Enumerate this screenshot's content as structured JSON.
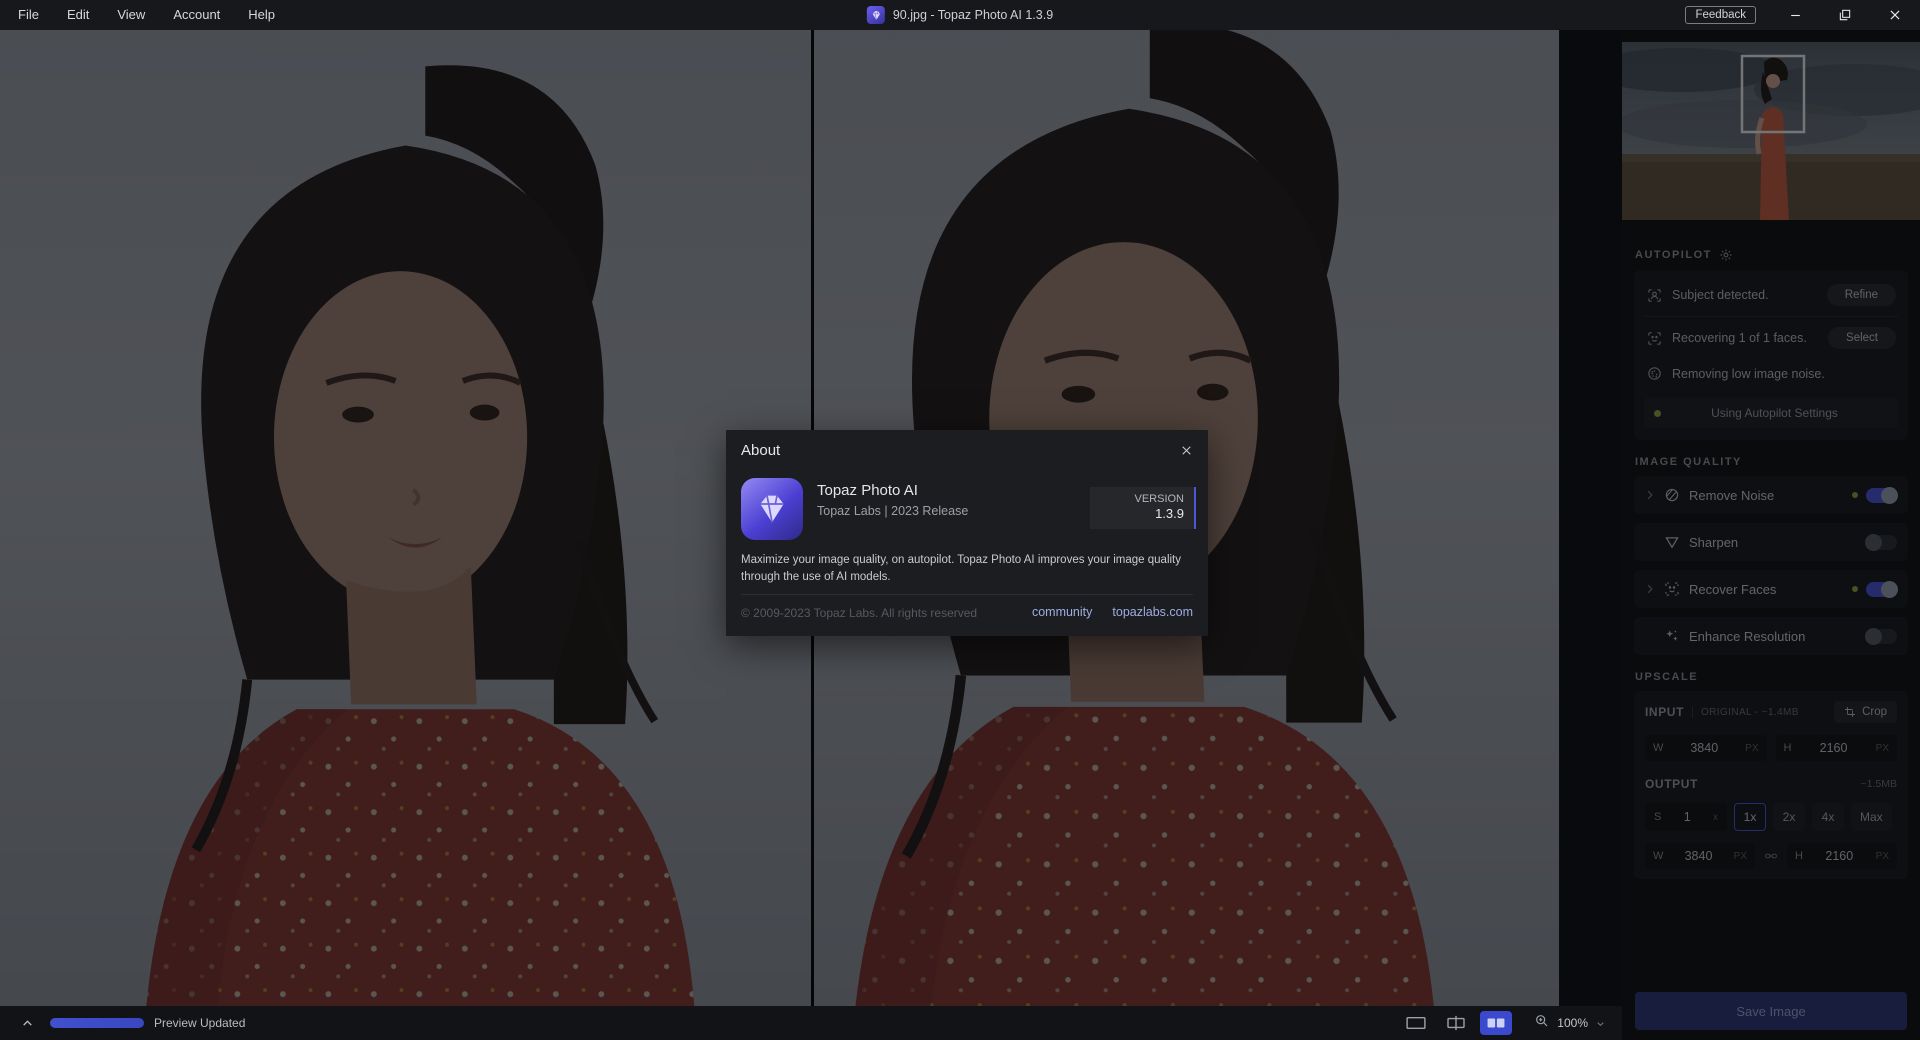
{
  "titlebar": {
    "menu": {
      "items": [
        {
          "label": "File"
        },
        {
          "label": "Edit"
        },
        {
          "label": "View"
        },
        {
          "label": "Account"
        },
        {
          "label": "Help"
        }
      ]
    },
    "title": "90.jpg - Topaz Photo AI 1.3.9",
    "feedback_label": "Feedback"
  },
  "dialog": {
    "title": "About",
    "app_name": "Topaz Photo AI",
    "app_subtitle": "Topaz Labs | 2023 Release",
    "version_label": "VERSION",
    "version_value": "1.3.9",
    "description": "Maximize your image quality, on autopilot. Topaz Photo AI improves your image quality through the use of AI models.",
    "copyright": "© 2009-2023 Topaz Labs. All rights reserved",
    "links": [
      {
        "label": "community"
      },
      {
        "label": "topazlabs.com"
      }
    ]
  },
  "sidebar": {
    "autopilot": {
      "header": "AUTOPILOT",
      "rows": [
        {
          "label": "Subject detected.",
          "button": "Refine"
        },
        {
          "label": "Recovering 1 of 1 faces.",
          "button": "Select"
        },
        {
          "label": "Removing low image noise."
        }
      ],
      "status": "Using Autopilot Settings"
    },
    "image_quality": {
      "header": "IMAGE QUALITY",
      "items": [
        {
          "label": "Remove Noise",
          "enabled": true
        },
        {
          "label": "Sharpen",
          "enabled": false
        },
        {
          "label": "Recover Faces",
          "enabled": true
        },
        {
          "label": "Enhance Resolution",
          "enabled": false
        }
      ]
    },
    "upscale": {
      "header": "UPSCALE",
      "input_label": "INPUT",
      "input_meta": "ORIGINAL - ~1.4MB",
      "crop_label": "Crop",
      "input_w_label": "W",
      "input_w": "3840",
      "input_w_unit": "PX",
      "input_h_label": "H",
      "input_h": "2160",
      "input_h_unit": "PX",
      "output_label": "OUTPUT",
      "output_meta": "~1.5MB",
      "scale_custom": {
        "prefix": "S",
        "value": "1",
        "suffix": "x"
      },
      "scale_options": [
        {
          "label": "1x",
          "selected": true
        },
        {
          "label": "2x",
          "selected": false
        },
        {
          "label": "4x",
          "selected": false
        },
        {
          "label": "Max",
          "selected": false
        }
      ],
      "output_w_label": "W",
      "output_w": "3840",
      "output_w_unit": "PX",
      "output_h_label": "H",
      "output_h": "2160",
      "output_h_unit": "PX"
    },
    "save_button": "Save Image"
  },
  "statusbar": {
    "preview_status": "Preview Updated",
    "zoom_level": "100%"
  },
  "colors": {
    "accent": "#4150d8",
    "toggle_on": "#4753d8",
    "green_dot": "#8ca43c",
    "link": "#9fade2",
    "version_bar": "#4a58d8"
  }
}
